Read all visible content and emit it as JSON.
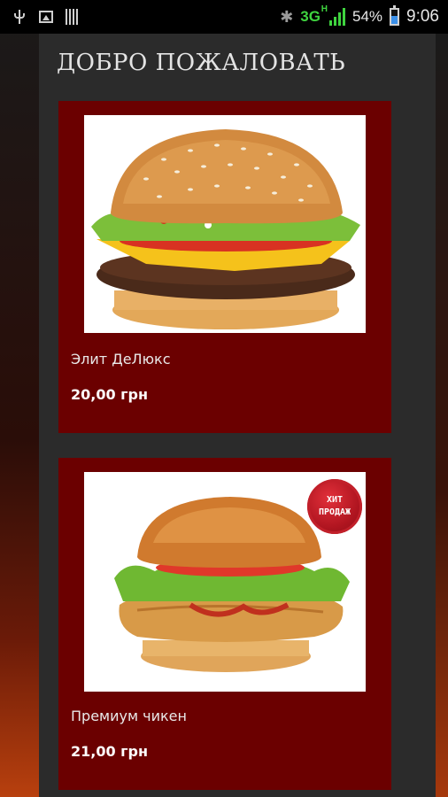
{
  "statusbar": {
    "network": "3G",
    "network_sub": "H",
    "battery": "54%",
    "time": "9:06"
  },
  "header": {
    "title": "ДОБРО ПОЖАЛОВАТЬ"
  },
  "products": [
    {
      "name": "Элит ДеЛюкс",
      "price": "20,00 грн"
    },
    {
      "name": "Премиум чикен",
      "price": "21,00 грн",
      "badge_line1": "ХИТ",
      "badge_line2": "ПРОДАЖ"
    }
  ],
  "colors": {
    "card": "#6b0000",
    "panel": "#2b2b2b",
    "network": "#3fd43f",
    "badge": "#c2202a"
  }
}
